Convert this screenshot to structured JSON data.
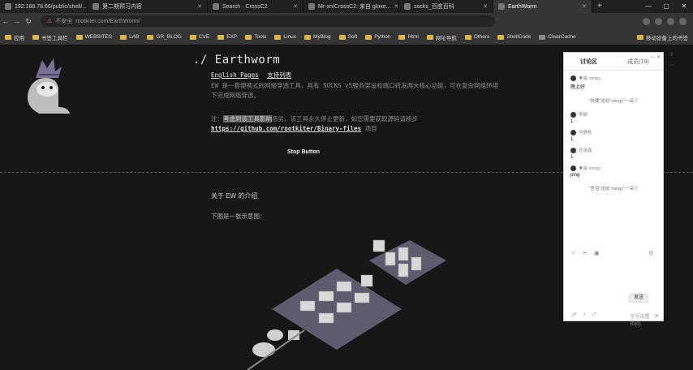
{
  "tabs": [
    {
      "title": "192.168.78.66/public/shell/..."
    },
    {
      "title": "第二期预习内容"
    },
    {
      "title": "Search · CrossC2"
    },
    {
      "title": "Mr-xn/CrossC2: 来自 gloxe..."
    },
    {
      "title": "socks_百度百科"
    },
    {
      "title": "EarthWorm"
    }
  ],
  "new_tab": "+",
  "window_controls": {
    "minimize": "—",
    "maximize": "▢",
    "close": "✕"
  },
  "address": {
    "insecure": "不安全",
    "url": "rootkiter.com/EarthWorm/"
  },
  "bookmarks": [
    "应用",
    "书签工具栏",
    "WEBSITES",
    "LAB",
    "GR_BLOG",
    "CVE",
    "EXP",
    "Tools",
    "Linux",
    "MyBlog",
    "Soft",
    "Python",
    "Html",
    "网址导航",
    "Others",
    "ShellCode",
    "ClearCache"
  ],
  "bookmarks_right": "移动设备上的书签",
  "page": {
    "title": "./ Earthworm",
    "link_english": "English Pages",
    "link_support": "支持列表",
    "description": "EW 是一套便携式的网络穿透工具，具有 SOCKS v5服务架设和端口转发两大核心功能，可在复杂网络环境下完成网络穿透。",
    "note_prefix": "注：",
    "note_highlight": "考虑到该工具影响",
    "note_middle": "恶劣，该工具永久停止更新，如您需要获取源码请移步",
    "note_url": "https://github.com/rootkiter/Binary-files",
    "note_suffix": "项目",
    "stop_button": "Stop Button",
    "about_heading": "关于 EW 的介绍",
    "about_sub": "下图是一张示意图："
  },
  "chat": {
    "tab_discussion": "讨论区",
    "tab_members": "成员(19)",
    "controls": "— ✕",
    "messages": [
      {
        "type": "msg",
        "user": "☀遥 mingy",
        "text": "晚上好"
      },
      {
        "type": "sys",
        "text": "\"快要\"送给\"mingy\"一朵❀"
      },
      {
        "type": "msg",
        "user": "李颖",
        "text": "1"
      },
      {
        "type": "msg",
        "user": "何静秋",
        "text": "1"
      },
      {
        "type": "msg",
        "user": "任承鑫",
        "text": "1"
      },
      {
        "type": "msg",
        "user": "☀遥 mingy",
        "text": "ping"
      },
      {
        "type": "sys",
        "text": "\"吾道\"送给\"mingy\"一朵❀"
      }
    ],
    "send_label": "发送",
    "footer_right": "字号设置 · 评价(0)"
  },
  "colors": {
    "page_bg": "#161616",
    "chat_bg": "#ffffff",
    "accent": "#d9b44a"
  }
}
